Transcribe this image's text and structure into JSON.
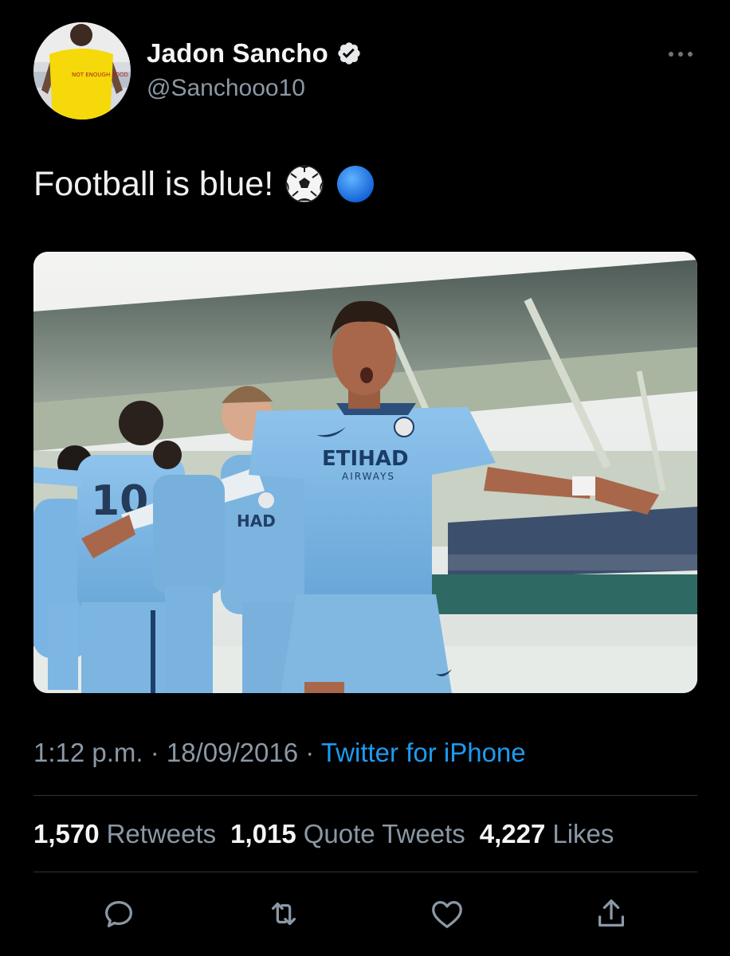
{
  "author": {
    "display_name": "Jadon Sancho",
    "handle": "@Sanchooo10",
    "verified_icon": "verified-badge-icon",
    "avatar_shirt_text": "NOT ENOUGH FOOD"
  },
  "tweet": {
    "text": "Football is blue!",
    "emojis": [
      "soccer-ball-emoji",
      "blue-circle-emoji"
    ],
    "media": {
      "shirt_sponsor": "ETIHAD",
      "shirt_sponsor_sub": "AIRWAYS",
      "back_number": "10"
    }
  },
  "meta": {
    "time": "1:12 p.m.",
    "separator": "·",
    "date": "18/09/2016",
    "source": "Twitter for iPhone"
  },
  "stats": {
    "retweets_count": "1,570",
    "retweets_label": "Retweets",
    "quotes_count": "1,015",
    "quotes_label": "Quote Tweets",
    "likes_count": "4,227",
    "likes_label": "Likes"
  },
  "actions": [
    "reply-icon",
    "retweet-icon",
    "like-icon",
    "share-icon"
  ],
  "colors": {
    "background": "#000000",
    "primary_text": "#f5f5f5",
    "secondary_text": "#8b98a5",
    "link": "#1d9bf0",
    "divider": "#2f3336",
    "verified_badge": "#e7e9ea"
  }
}
